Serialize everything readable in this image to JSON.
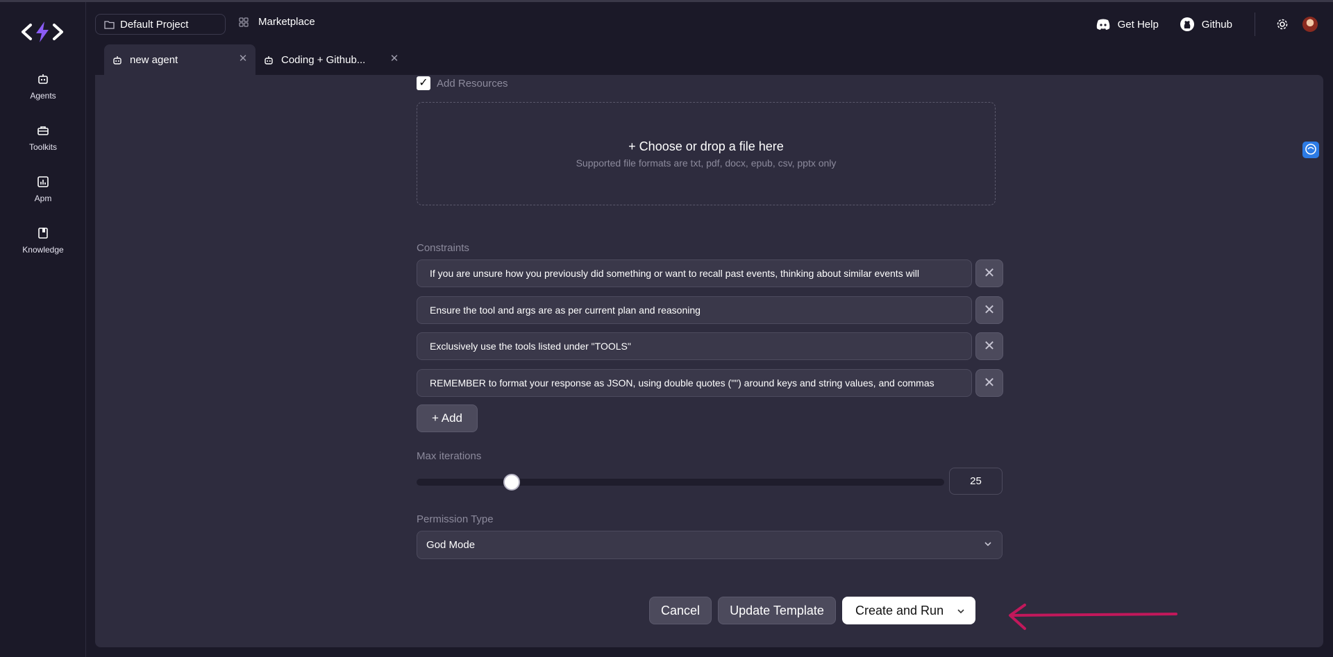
{
  "colors": {
    "accent_arrow": "#c2185b",
    "logo_bolt": "#8b5cf6",
    "badge_blue": "#2c7be5"
  },
  "sidebar": {
    "items": [
      {
        "label": "Agents",
        "icon": "robot-icon"
      },
      {
        "label": "Toolkits",
        "icon": "toolbox-icon"
      },
      {
        "label": "Apm",
        "icon": "chart-icon"
      },
      {
        "label": "Knowledge",
        "icon": "book-icon"
      }
    ]
  },
  "topbar": {
    "project": "Default Project",
    "marketplace": "Marketplace",
    "get_help": "Get Help",
    "github": "Github"
  },
  "tabs": [
    {
      "label": "new agent",
      "active": true
    },
    {
      "label": "Coding + Github...",
      "active": false
    }
  ],
  "form": {
    "add_resources_label": "Add Resources",
    "add_resources_checked": true,
    "dropzone_title": "+ Choose or drop a file here",
    "dropzone_sub": "Supported file formats are txt, pdf, docx, epub, csv, pptx only",
    "constraints_label": "Constraints",
    "constraints": [
      "If you are unsure how you previously did something or want to recall past events, thinking about similar events will",
      "Ensure the tool and args are as per current plan and reasoning",
      "Exclusively use the tools listed under \"TOOLS\"",
      "REMEMBER to format your response as JSON, using double quotes (\"\") around keys and string values, and commas"
    ],
    "add_label": "+ Add",
    "max_iterations_label": "Max iterations",
    "max_iterations_value": "25",
    "max_iterations_fraction": 0.18,
    "permission_label": "Permission Type",
    "permission_value": "God Mode"
  },
  "actions": {
    "cancel": "Cancel",
    "update_template": "Update Template",
    "create_run": "Create and Run"
  }
}
